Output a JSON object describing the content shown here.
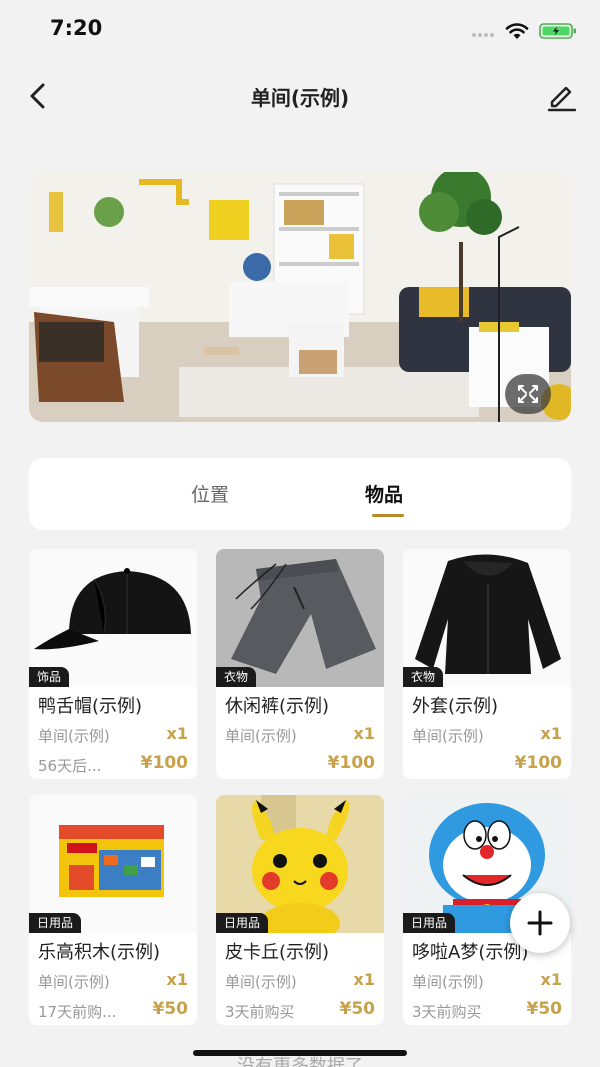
{
  "status_bar": {
    "time": "7:20"
  },
  "nav": {
    "title": "单间(示例)"
  },
  "tabs": [
    {
      "label": "位置",
      "active": false
    },
    {
      "label": "物品",
      "active": true
    }
  ],
  "items": [
    {
      "tag": "饰品",
      "name": "鸭舌帽(示例)",
      "location": "单间(示例)",
      "qty": "x1",
      "date": "56天后...",
      "price": "¥100"
    },
    {
      "tag": "衣物",
      "name": "休闲裤(示例)",
      "location": "单间(示例)",
      "qty": "x1",
      "date": "",
      "price": "¥100"
    },
    {
      "tag": "衣物",
      "name": "外套(示例)",
      "location": "单间(示例)",
      "qty": "x1",
      "date": "",
      "price": "¥100"
    },
    {
      "tag": "日用品",
      "name": "乐高积木(示例)",
      "location": "单间(示例)",
      "qty": "x1",
      "date": "17天前购...",
      "price": "¥50"
    },
    {
      "tag": "日用品",
      "name": "皮卡丘(示例)",
      "location": "单间(示例)",
      "qty": "x1",
      "date": "3天前购买",
      "price": "¥50"
    },
    {
      "tag": "日用品",
      "name": "哆啦A梦(示例)",
      "location": "单间(示例)",
      "qty": "x1",
      "date": "3天前购买",
      "price": "¥50"
    }
  ],
  "footer": {
    "no_more": "没有更多数据了"
  },
  "colors": {
    "accent": "#c7a24a",
    "tab_underline": "#b98a2a",
    "background": "#f2f2f2"
  },
  "icons": {
    "back": "chevron-left-icon",
    "edit": "pencil-icon",
    "expand": "expand-icon",
    "add": "plus-icon"
  }
}
